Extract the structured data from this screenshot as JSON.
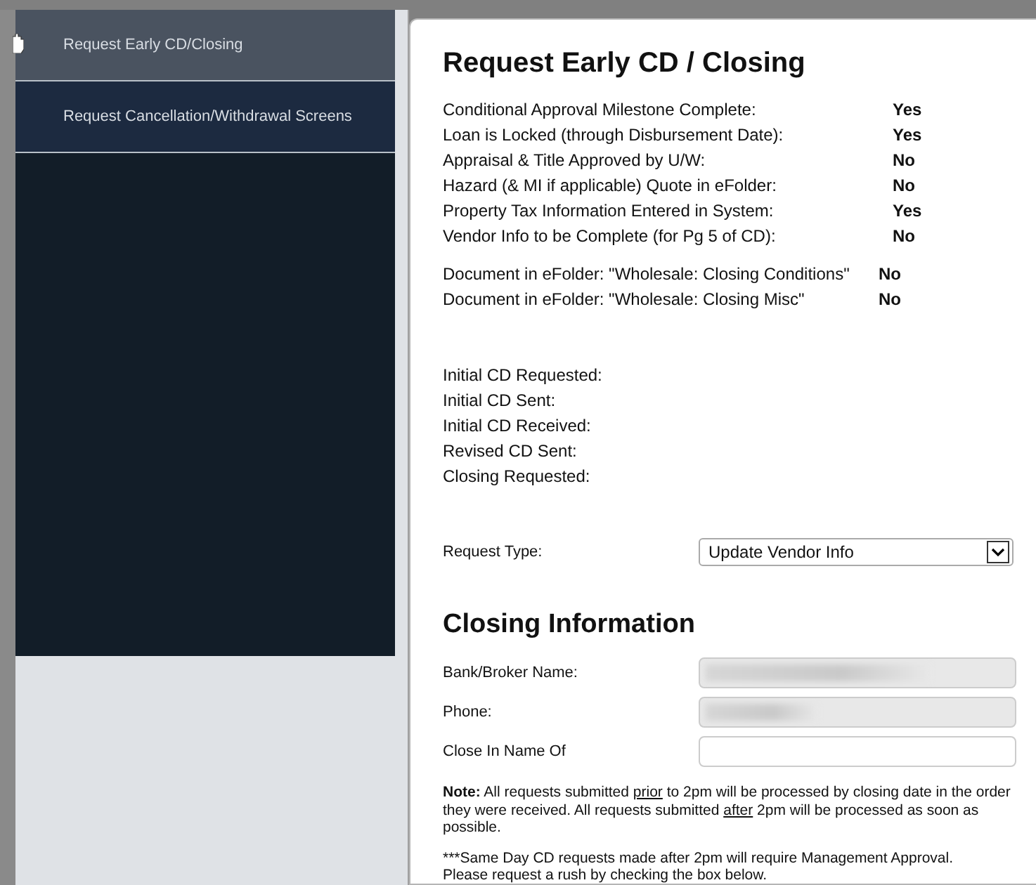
{
  "sidebar": {
    "items": [
      {
        "label": "Request Early CD/Closing",
        "selected": true
      },
      {
        "label": "Request Cancellation/Withdrawal Screens",
        "selected": false
      }
    ]
  },
  "title": "Request Early CD / Closing",
  "checklist": [
    {
      "label": "Conditional Approval Milestone Complete:",
      "value": "Yes"
    },
    {
      "label": "Loan is Locked (through Disbursement Date):",
      "value": "Yes"
    },
    {
      "label": "Appraisal & Title Approved by U/W:",
      "value": "No"
    },
    {
      "label": "Hazard (& MI if applicable) Quote in eFolder:",
      "value": "No"
    },
    {
      "label": "Property Tax Information Entered in System:",
      "value": "Yes"
    },
    {
      "label": "Vendor Info to be Complete (for Pg 5 of CD):",
      "value": "No"
    }
  ],
  "documents": [
    {
      "label": "Document in eFolder: \"Wholesale: Closing Conditions\"",
      "value": "No"
    },
    {
      "label": "Document in eFolder: \"Wholesale: Closing Misc\"",
      "value": "No"
    }
  ],
  "dates": [
    "Initial CD Requested:",
    "Initial CD Sent:",
    "Initial CD Received:",
    "Revised CD Sent:",
    "Closing Requested:"
  ],
  "request_type": {
    "label": "Request Type:",
    "value": "Update Vendor Info"
  },
  "closing_title": "Closing Information",
  "closing_fields": [
    {
      "label": "Bank/Broker Name:",
      "disabled": true,
      "redacted": true
    },
    {
      "label": "Phone:",
      "disabled": true,
      "redacted": true
    },
    {
      "label": "Close In Name Of",
      "disabled": false,
      "redacted": false
    }
  ],
  "note": [
    {
      "text": "Note:",
      "kind": "bold"
    },
    {
      "text": " All requests submitted ",
      "kind": "plain"
    },
    {
      "text": "prior",
      "kind": "underline"
    },
    {
      "text": " to 2pm will be processed by closing date in the order they were received. All requests submitted ",
      "kind": "plain"
    },
    {
      "text": "after",
      "kind": "underline"
    },
    {
      "text": " 2pm will be processed as soon as possible.",
      "kind": "plain"
    }
  ],
  "rush_note": [
    "***Same Day CD requests made after 2pm will require Management Approval.",
    "Please request a rush by checking the box below."
  ]
}
